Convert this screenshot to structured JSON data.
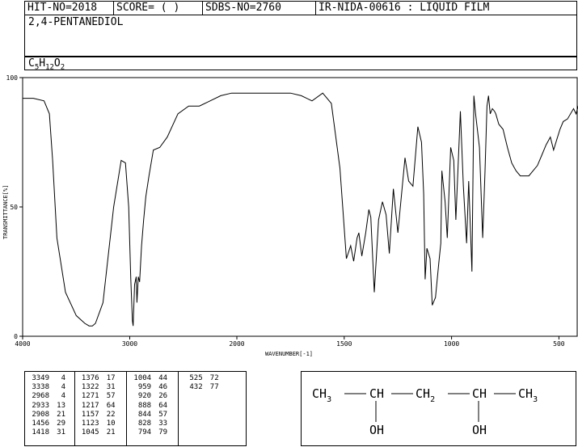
{
  "header": {
    "hit_no": "HIT-NO=2018",
    "score": "SCORE=  (   )",
    "sdbs_no": "SDBS-NO=2760",
    "ir_nida": "IR-NIDA-00616 : LIQUID FILM"
  },
  "compound_name": "2,4-PENTANEDIOL",
  "formula": {
    "p1": "C",
    "s1": "5",
    "p2": "H",
    "s2": "12",
    "p3": "O",
    "s3": "2"
  },
  "chart_data": {
    "type": "line",
    "xlabel": "WAVENUMBER[-1]",
    "ylabel": "TRANSMITTANCE[%]",
    "xlim": [
      4000,
      400
    ],
    "ylim": [
      0,
      100
    ],
    "x_ticks": [
      4000,
      3000,
      2000,
      1500,
      1000,
      500
    ],
    "x_tick_labels": [
      "4000",
      "3000",
      "2000",
      "1500",
      "1000",
      "500"
    ],
    "y_ticks": [
      0,
      50,
      100
    ],
    "y_tick_labels": [
      "0",
      "50",
      "100"
    ],
    "series": [
      {
        "x": [
          4000,
          3900,
          3800,
          3750,
          3720,
          3680,
          3600,
          3500,
          3420,
          3380,
          3349,
          3320,
          3250,
          3150,
          3080,
          3040,
          3010,
          2990,
          2975,
          2968,
          2955,
          2940,
          2933,
          2920,
          2908,
          2890,
          2870,
          2850,
          2820,
          2780,
          2720,
          2650,
          2550,
          2450,
          2350,
          2250,
          2150,
          2050,
          1950,
          1850,
          1750,
          1700,
          1650,
          1600,
          1560,
          1520,
          1490,
          1470,
          1456,
          1440,
          1432,
          1418,
          1400,
          1385,
          1376,
          1360,
          1340,
          1322,
          1305,
          1290,
          1271,
          1250,
          1217,
          1200,
          1180,
          1157,
          1140,
          1130,
          1123,
          1115,
          1100,
          1090,
          1075,
          1060,
          1050,
          1045,
          1030,
          1020,
          1004,
          990,
          980,
          959,
          945,
          930,
          920,
          905,
          896,
          888,
          870,
          855,
          844,
          835,
          828,
          820,
          810,
          800,
          794,
          780,
          760,
          740,
          720,
          700,
          680,
          660,
          640,
          620,
          600,
          580,
          560,
          540,
          525,
          510,
          495,
          480,
          460,
          432,
          420,
          400
        ],
        "y": [
          92,
          92,
          91,
          86,
          68,
          38,
          17,
          8,
          5,
          4,
          4,
          5,
          13,
          50,
          68,
          67,
          50,
          22,
          6,
          4,
          20,
          23,
          13,
          23,
          21,
          35,
          45,
          54,
          62,
          72,
          73,
          77,
          86,
          89,
          89,
          91,
          93,
          94,
          94,
          94,
          94,
          93,
          91,
          94,
          90,
          65,
          30,
          35,
          29,
          38,
          40,
          31,
          40,
          49,
          46,
          17,
          45,
          52,
          47,
          32,
          57,
          40,
          69,
          60,
          58,
          81,
          75,
          55,
          22,
          34,
          30,
          12,
          15,
          28,
          36,
          64,
          52,
          38,
          73,
          68,
          45,
          87,
          58,
          36,
          60,
          25,
          93,
          86,
          73,
          38,
          64,
          89,
          93,
          86,
          88,
          87,
          86,
          82,
          80,
          73,
          67,
          64,
          62,
          62,
          62,
          64,
          66,
          70,
          74,
          77,
          72,
          76,
          80,
          83,
          84,
          88,
          86,
          92
        ]
      }
    ]
  },
  "peak_table": {
    "columns": [
      [
        [
          "3349",
          "4"
        ],
        [
          "3338",
          "4"
        ],
        [
          "2968",
          "4"
        ],
        [
          "2933",
          "13"
        ],
        [
          "2908",
          "21"
        ],
        [
          "1456",
          "29"
        ],
        [
          "1418",
          "31"
        ]
      ],
      [
        [
          "1376",
          "17"
        ],
        [
          "1322",
          "31"
        ],
        [
          "1271",
          "57"
        ],
        [
          "1217",
          "64"
        ],
        [
          "1157",
          "22"
        ],
        [
          "1123",
          "10"
        ],
        [
          "1045",
          "21"
        ]
      ],
      [
        [
          "1004",
          "44"
        ],
        [
          "959",
          "46"
        ],
        [
          "920",
          "26"
        ],
        [
          "888",
          "64"
        ],
        [
          "844",
          "57"
        ],
        [
          "828",
          "33"
        ],
        [
          "794",
          "79"
        ]
      ],
      [
        [
          "525",
          "72"
        ],
        [
          "432",
          "77"
        ]
      ]
    ]
  },
  "structure": {
    "ch3_left": "CH",
    "ch3_left_sub": "3",
    "ch_1": "CH",
    "ch2": "CH",
    "ch2_sub": "2",
    "ch_2": "CH",
    "ch3_right": "CH",
    "ch3_right_sub": "3",
    "oh_1": "OH",
    "oh_2": "OH"
  }
}
